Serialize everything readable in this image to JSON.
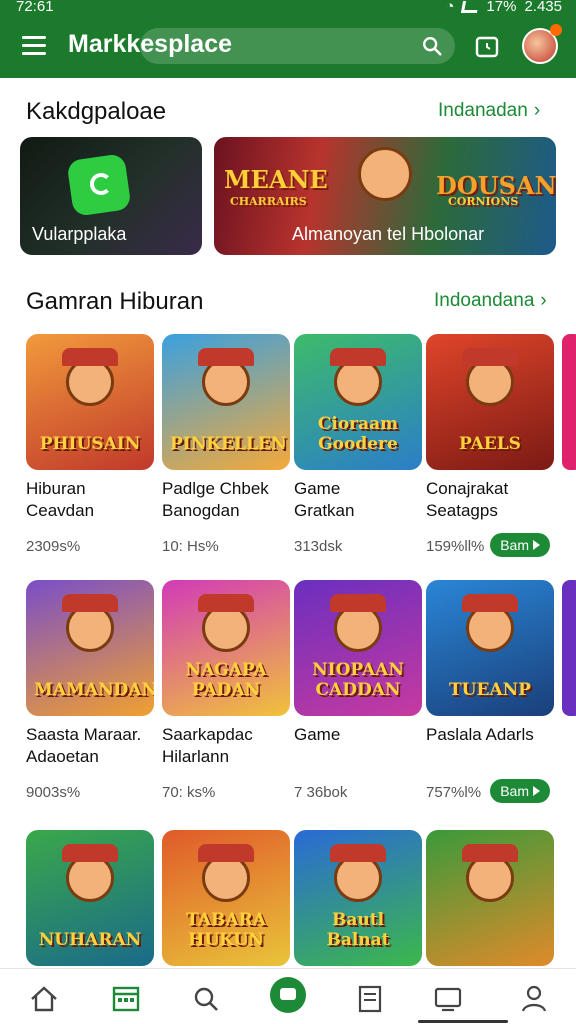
{
  "status_bar": {
    "time": "72:61",
    "battery": "17%",
    "clock_right": "2.435"
  },
  "app_bar": {
    "title": "Markkesplace"
  },
  "featured": {
    "title": "Kakdgpaloae",
    "more": "Indanadan",
    "banners": [
      {
        "label": "Vularpplaka"
      },
      {
        "label": "Almanoyan tel Hbolonar",
        "logo_left": "MEANE",
        "logo_left_sub": "CHARRAIRS",
        "logo_right": "DOUSAN",
        "logo_right_sub": "CORNIONS"
      }
    ]
  },
  "games_section": {
    "title": "Gamran Hiburan",
    "more": "Indoandana",
    "rows": [
      [
        {
          "name": "Hiburan\nCeavdan",
          "meta": "2309s%",
          "logo": "PHIUSAIN",
          "colors": [
            "#f29a3c",
            "#c0392b"
          ]
        },
        {
          "name": "Padlge Chbek\nBanogdan",
          "meta": "10: Hs%",
          "logo": "PINKELLEN",
          "colors": [
            "#3aa0e0",
            "#f4a93a"
          ]
        },
        {
          "name": "Game\nGratkan",
          "meta": "313dsk",
          "logo": "Cioraam Goodere",
          "colors": [
            "#3dbb6a",
            "#2b7ec9"
          ]
        },
        {
          "name": "Conajrakat\nSeatagps",
          "meta": "159%ll%",
          "logo": "PAELS",
          "colors": [
            "#e0452a",
            "#7b1a14"
          ],
          "button": "Bam"
        }
      ],
      [
        {
          "name": "Saasta Maraar.\nAdaoetan",
          "meta": "9003s%",
          "logo": "MAMANDAN",
          "colors": [
            "#7a4ec9",
            "#f0a030"
          ]
        },
        {
          "name": "Saarkapdac\nHilarlann",
          "meta": "70: ks%",
          "logo": "NAGAPA PADAN",
          "colors": [
            "#d23ab8",
            "#f1c23a"
          ]
        },
        {
          "name": "Game\n",
          "meta": "7 36bok",
          "logo": "NIOPAAN CADDAN",
          "colors": [
            "#6a2fbf",
            "#c73aa0"
          ]
        },
        {
          "name": "Paslala Adarls\n",
          "meta": "757%l%",
          "logo": "TUEANP",
          "colors": [
            "#2a86d6",
            "#1a3f7a"
          ],
          "button": "Bam"
        }
      ],
      [
        {
          "name": "",
          "meta": "",
          "logo": "NUHARAN",
          "colors": [
            "#3aa84a",
            "#1a6a8a"
          ]
        },
        {
          "name": "",
          "meta": "",
          "logo": "TABARA HUKUN",
          "colors": [
            "#e05a2a",
            "#e9c43a"
          ]
        },
        {
          "name": "",
          "meta": "",
          "logo": "Bautl Balnat",
          "colors": [
            "#2a6ad6",
            "#3cb84a"
          ]
        },
        {
          "name": "",
          "meta": "",
          "logo": "",
          "colors": [
            "#3a9a3a",
            "#e08a2a"
          ]
        }
      ]
    ]
  },
  "bottom_nav": {
    "items": [
      "home-icon",
      "calendar-icon",
      "search-icon",
      "chat-icon",
      "receipt-icon",
      "monitor-icon",
      "profile-icon"
    ]
  }
}
